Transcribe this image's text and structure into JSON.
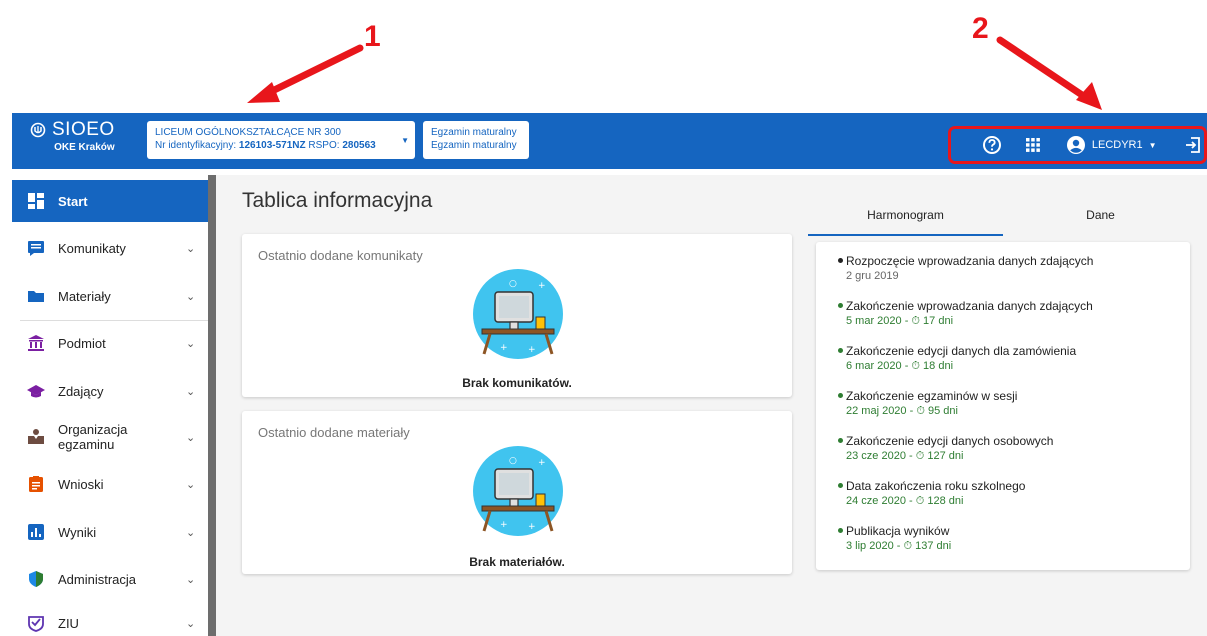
{
  "annotations": {
    "one": "1",
    "two": "2"
  },
  "header": {
    "app_name": "SIOEO",
    "app_sub": "OKE Kraków",
    "school": {
      "name": "LICEUM OGÓLNOKSZTAŁCĄCE NR 300",
      "id_prefix": "Nr identyfikacyjny: ",
      "id_value": "126103-571NZ",
      "rspo_prefix": " RSPO: ",
      "rspo_value": "280563"
    },
    "exam": {
      "line1": "Egzamin maturalny",
      "line2": "Egzamin maturalny"
    },
    "user": "LECDYR1"
  },
  "sidebar": {
    "items": [
      {
        "label": "Start",
        "icon": "dashboard-icon"
      },
      {
        "label": "Komunikaty",
        "icon": "message-icon"
      },
      {
        "label": "Materiały",
        "icon": "folder-icon"
      },
      {
        "label": "Podmiot",
        "icon": "institution-icon"
      },
      {
        "label": "Zdający",
        "icon": "graduation-cap-icon"
      },
      {
        "label": "Organizacja egzaminu",
        "icon": "organization-icon"
      },
      {
        "label": "Wnioski",
        "icon": "clipboard-icon"
      },
      {
        "label": "Wyniki",
        "icon": "bar-chart-icon"
      },
      {
        "label": "Administracja",
        "icon": "shield-icon"
      },
      {
        "label": "ZIU",
        "icon": "ziu-icon"
      }
    ]
  },
  "main": {
    "title": "Tablica informacyjna",
    "cards": [
      {
        "title": "Ostatnio dodane komunikaty",
        "empty": "Brak komunikatów."
      },
      {
        "title": "Ostatnio dodane materiały",
        "empty": "Brak materiałów."
      }
    ],
    "tabs": [
      {
        "label": "Harmonogram"
      },
      {
        "label": "Dane"
      }
    ],
    "schedule": [
      {
        "title": "Rozpoczęcie wprowadzania danych zdających",
        "date": "2 gru 2019",
        "active": false
      },
      {
        "title": "Zakończenie wprowadzania danych zdających",
        "date": "5 mar 2020 - ⏱ 17 dni",
        "active": true
      },
      {
        "title": "Zakończenie edycji danych dla zamówienia",
        "date": "6 mar 2020 - ⏱ 18 dni",
        "active": true
      },
      {
        "title": "Zakończenie egzaminów w sesji",
        "date": "22 maj 2020 - ⏱ 95 dni",
        "active": true
      },
      {
        "title": "Zakończenie edycji danych osobowych",
        "date": "23 cze 2020 - ⏱ 127 dni",
        "active": true
      },
      {
        "title": "Data zakończenia roku szkolnego",
        "date": "24 cze 2020 - ⏱ 128 dni",
        "active": true
      },
      {
        "title": "Publikacja wyników",
        "date": "3 lip 2020 - ⏱ 137 dni",
        "active": true
      }
    ]
  },
  "colors": {
    "brand": "#1565c0",
    "annotation": "#e8161b",
    "active_date": "#2e7d32",
    "muted_date": "#666666"
  }
}
